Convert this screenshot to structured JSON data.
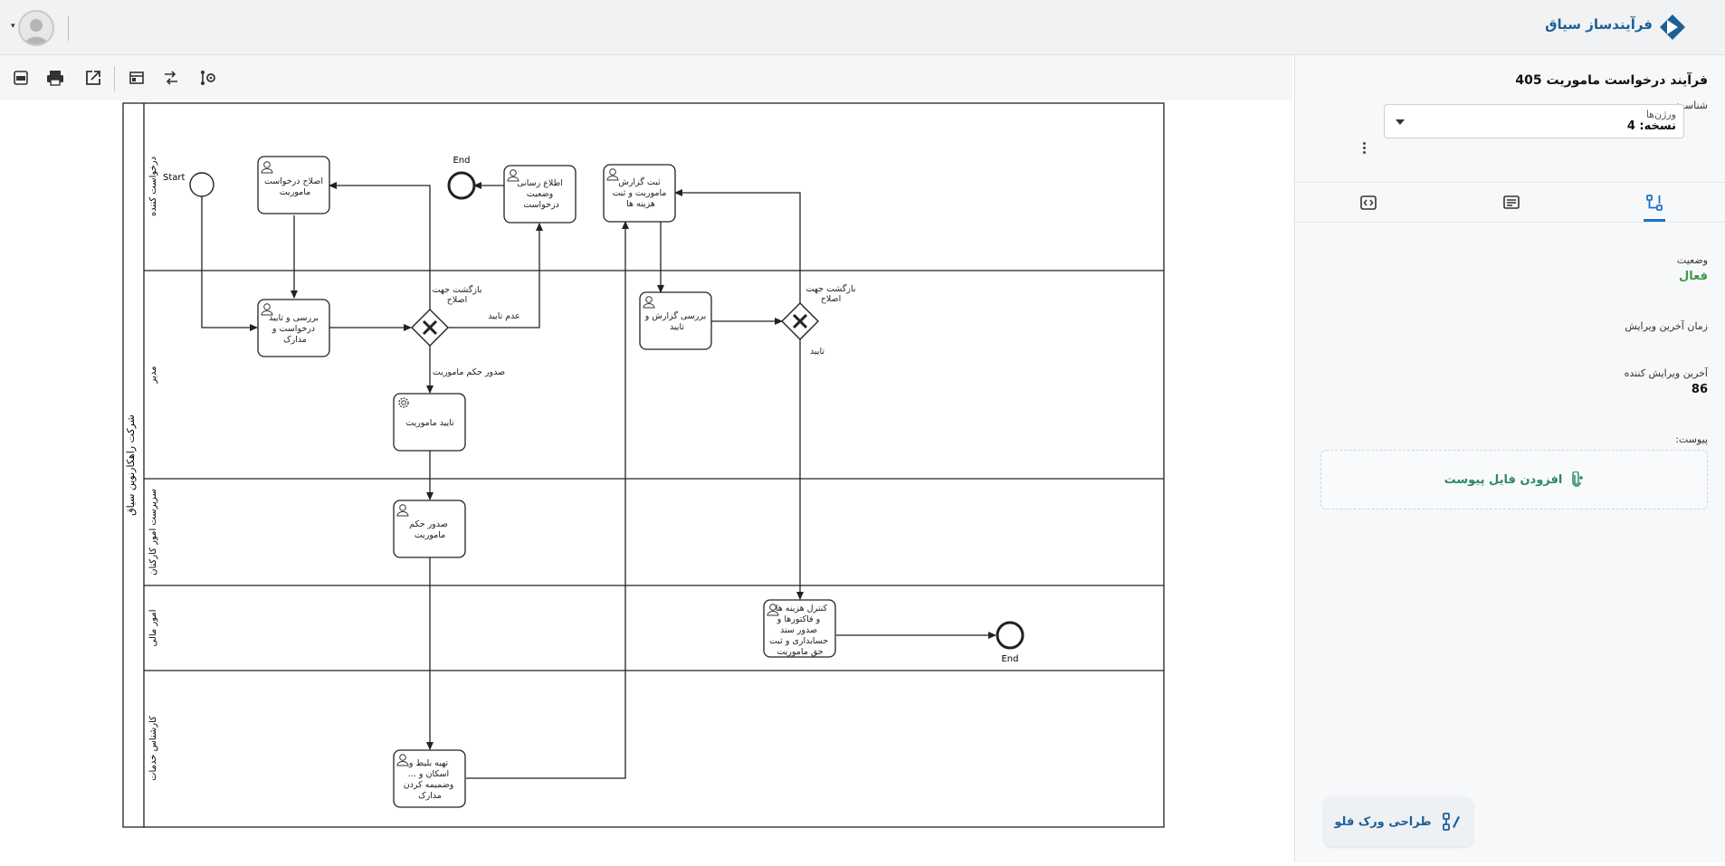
{
  "brand": {
    "name": "فرآیندساز سیاق"
  },
  "process": {
    "title": "فرآیند درخواست ماموریت 405",
    "id_label": "شناسه:",
    "version_label": "ورژن‌ها",
    "version_value": "نسخه: 4"
  },
  "details": {
    "status_label": "وضعیت",
    "status_value": "فعال",
    "status_color": "#3b9a4a",
    "last_edit_label": "زمان آخرین ویرایش",
    "editor_label": "آخرین ویرایش کننده",
    "editor_value": "86",
    "attachment_label": "پیوست:",
    "add_file": "افزودن فایل پیوست"
  },
  "design_button": "طراحی ورک فلو",
  "accent_color": "#1a73c8",
  "diagram": {
    "pool": "شرکت راهکارنوین سیاق",
    "lanes": {
      "l1": "درخواست کننده",
      "l2": "مدیر",
      "l3": "سرپرست امور کارکنان",
      "l4": "امور مالی",
      "l5": "کارشناس خدمات"
    },
    "start": "Start",
    "end1": "End",
    "end2": "End",
    "tasks": {
      "t1": [
        "اصلاح درخواست",
        "ماموریت"
      ],
      "t2": [
        "اطلاع رسانی",
        "وضعیت",
        "درخواست"
      ],
      "t3": [
        "ثبت گزارش",
        "ماموریت و ثبت",
        "هزینه ها"
      ],
      "t4": [
        "بررسی و تایید",
        "درخواست و",
        "مدارک"
      ],
      "t5": [
        "بررسی گزارش و",
        "تایید"
      ],
      "t6": [
        "تایید ماموریت"
      ],
      "t7": [
        "صدور حکم",
        "ماموریت"
      ],
      "t8": [
        "کنترل هزینه ها",
        "و فاکتورها و",
        "صدور سند",
        "حسابداری و ثبت",
        "حق ماموریت"
      ],
      "t9": [
        "تهیه بلیط و",
        "... اسکان و",
        "وضمیمه کردن",
        "مدارک"
      ]
    },
    "flows": {
      "back_fix_1": [
        "بازگشت جهت",
        "اصلاح"
      ],
      "reject": "عدم تایید",
      "issue_order": "صدور حکم ماموریت",
      "back_fix_2": [
        "بازگشت جهت",
        "اصلاح"
      ],
      "approve": "تایید"
    }
  },
  "icons": {
    "toolbar": [
      "xml-export-icon",
      "print-icon",
      "open-external-icon",
      "layout-icon",
      "swap-icon",
      "settings-flow-icon"
    ],
    "tabs": [
      "code-icon",
      "details-icon",
      "flow-icon"
    ]
  }
}
